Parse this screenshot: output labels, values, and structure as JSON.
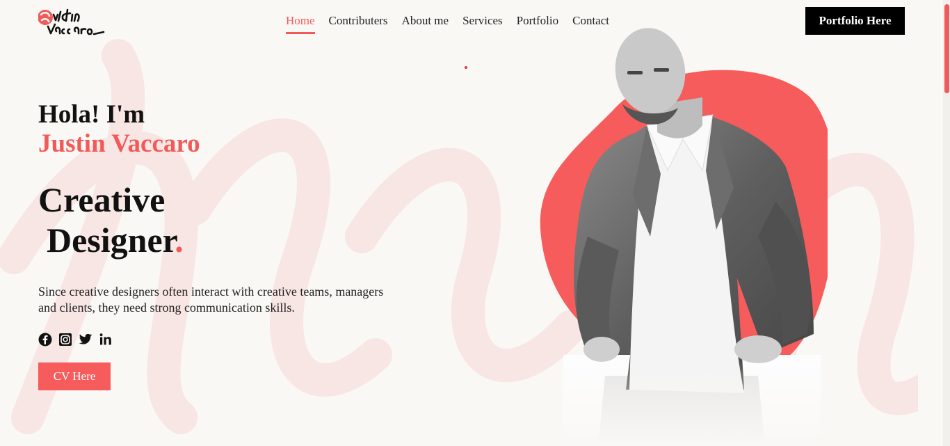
{
  "brand": {
    "logo_text": "Justin Vaccaro",
    "accent": "#f25a5a"
  },
  "nav": {
    "items": [
      {
        "label": "Home",
        "active": true
      },
      {
        "label": "Contributers",
        "active": false
      },
      {
        "label": "About me",
        "active": false
      },
      {
        "label": "Services",
        "active": false
      },
      {
        "label": "Portfolio",
        "active": false
      },
      {
        "label": "Contact",
        "active": false
      }
    ],
    "cta_label": "Portfolio Here"
  },
  "hero": {
    "greeting": "Hola! I'm",
    "name": "Justin Vaccaro",
    "role_line1": "Creative",
    "role_line2": "Designer",
    "role_punct": ".",
    "description": "Since creative designers often interact with creative teams, managers and clients, they need strong communication skills.",
    "socials": [
      "facebook-icon",
      "instagram-icon",
      "twitter-icon",
      "linkedin-icon"
    ],
    "cv_label": "CV Here"
  }
}
